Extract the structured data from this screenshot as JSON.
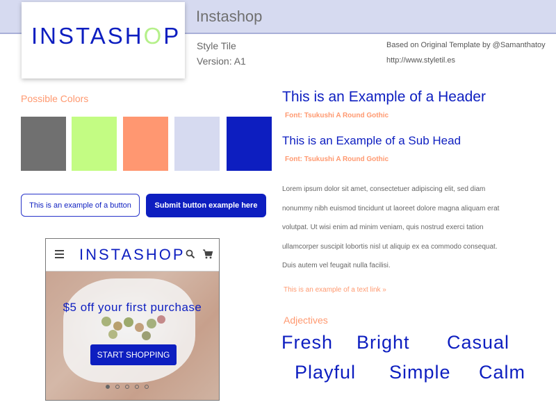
{
  "header": {
    "app_title": "Instashop",
    "logo_prefix": "INSTASH",
    "logo_o": "O",
    "logo_suffix": "P"
  },
  "style_tile": {
    "title": "Style Tile",
    "version": "Version: A1",
    "credit_line": "Based on Original Template by @Samanthatoy",
    "credit_url": "http://www.styletil.es"
  },
  "colors": {
    "label": "Possible Colors",
    "swatches": [
      "#707070",
      "#c3fc83",
      "#ff9771",
      "#d6daf0",
      "#0d1ec0"
    ]
  },
  "buttons": {
    "outline_label": "This is an example of a button",
    "submit_label": "Submit button example here"
  },
  "phone": {
    "logo": "INSTASHOP",
    "hero_text": "$5 off your first purchase",
    "cta_label": "START SHOPPING",
    "icons": [
      "menu-icon",
      "search-icon",
      "cart-icon"
    ],
    "carousel": {
      "count": 5,
      "active": 1
    }
  },
  "typography": {
    "header_example": "This is an Example of a Header",
    "header_font": "Font: Tsukushi A Round Gothic",
    "subhead_example": "This is an Example of a Sub Head",
    "subhead_font": "Font: Tsukushi A Round Gothic",
    "body_lines": [
      "Lorem ipsum dolor sit amet, consectetuer adipiscing elit, sed diam",
      "nonummy nibh euismod tincidunt ut laoreet dolore magna aliquam erat",
      "volutpat. Ut wisi enim ad minim veniam, quis nostrud exerci tation",
      "ullamcorper suscipit lobortis nisl ut aliquip ex ea commodo consequat.",
      "Duis autem vel feugait nulla facilisi."
    ],
    "text_link": "This is an example of a text link »"
  },
  "adjectives": {
    "label": "Adjectives",
    "items": [
      "Fresh",
      "Bright",
      "Casual",
      "Playful",
      "Simple",
      "Calm"
    ]
  }
}
